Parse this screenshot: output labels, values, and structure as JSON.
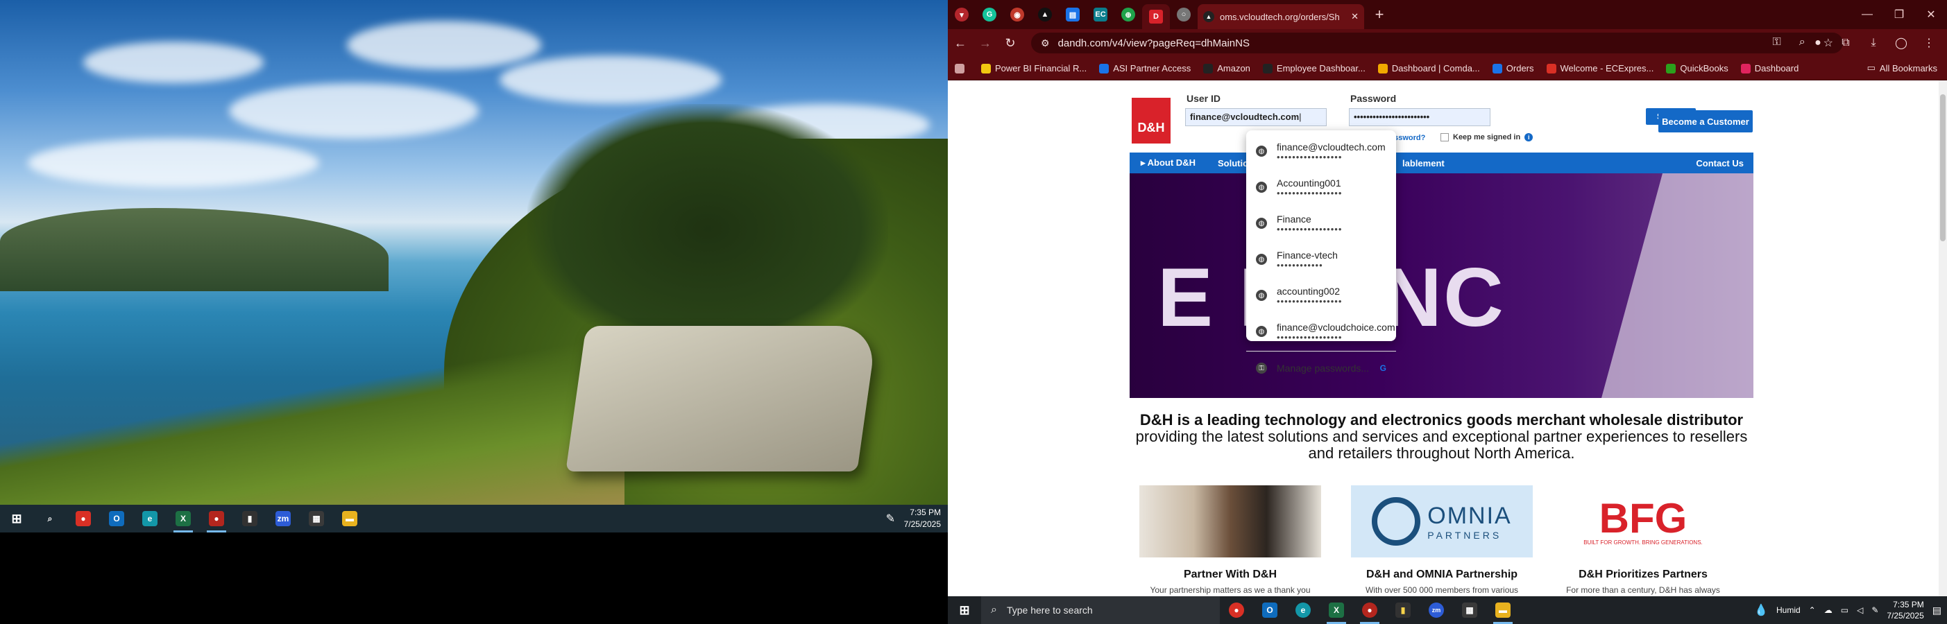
{
  "left_monitor": {
    "taskbar": {
      "icons": [
        {
          "name": "start-icon",
          "glyph": "⊞",
          "color": "#1b2a33",
          "active": false
        },
        {
          "name": "search-icon",
          "glyph": "⌕",
          "color": "#1b2a33",
          "active": false
        },
        {
          "name": "chrome-icon",
          "glyph": "●",
          "color": "#d93025",
          "active": false
        },
        {
          "name": "outlook-icon",
          "glyph": "O",
          "color": "#0f6cbd",
          "active": false
        },
        {
          "name": "edge-icon",
          "glyph": "e",
          "color": "#1397a8",
          "active": false
        },
        {
          "name": "excel-icon",
          "glyph": "X",
          "color": "#1d7044",
          "active": true
        },
        {
          "name": "chrome-profile-icon",
          "glyph": "●",
          "color": "#b3261e",
          "active": true
        },
        {
          "name": "sticky-notes-icon",
          "glyph": "▮",
          "color": "#323232",
          "active": false
        },
        {
          "name": "zoom-icon",
          "glyph": "zm",
          "color": "#2d5cd6",
          "active": false
        },
        {
          "name": "calculator-icon",
          "glyph": "▦",
          "color": "#3a3a3a",
          "active": false
        },
        {
          "name": "file-explorer-icon",
          "glyph": "▬",
          "color": "#e8b21f",
          "active": false
        }
      ],
      "time": "7:35 PM",
      "date": "7/25/2025"
    }
  },
  "browser": {
    "accent": "#5a0b10",
    "tabs": {
      "favicons": [
        "profile-menu",
        "grammarly",
        "tab-red",
        "tab-black",
        "tab-google-docs",
        "tab-ec",
        "tab-green",
        "tab-active-red",
        "tab-gray"
      ],
      "active_tab_title": "oms.vcloudtech.org/orders/Sh"
    },
    "url": "dandh.com/v4/view?pageReq=dhMainNS",
    "bookmarks": [
      {
        "label": "",
        "color": "#cfa0a0"
      },
      {
        "label": "Power BI Financial R...",
        "color": "#f2c811"
      },
      {
        "label": "ASI Partner Access",
        "color": "#1a73e8"
      },
      {
        "label": "Amazon",
        "color": "#222222"
      },
      {
        "label": "Employee Dashboar...",
        "color": "#222222"
      },
      {
        "label": "Dashboard | Comda...",
        "color": "#f2a900"
      },
      {
        "label": "Orders",
        "color": "#1a73e8"
      },
      {
        "label": "Welcome - ECExpres...",
        "color": "#d93025"
      },
      {
        "label": "QuickBooks",
        "color": "#2ca01c"
      },
      {
        "label": "Dashboard",
        "color": "#e0245e"
      }
    ],
    "all_bookmarks": "All Bookmarks"
  },
  "page": {
    "logo_text": "D&H",
    "user_id_label": "User ID",
    "user_id_value": "finance@vcloudtech.com",
    "password_label": "Password",
    "password_value": "••••••••••••••••••••••••",
    "signin_label": "Sign In",
    "forgot_label": "assword?",
    "keep_label": "Keep me signed in",
    "become_label": "Become a Customer",
    "nav": [
      "About D&H",
      "Solutio",
      "lablement"
    ],
    "nav_contact": "Contact Us",
    "hero_text": "E   RIENC",
    "headline_bold": "D&H is a leading technology and electronics goods merchant wholesale distributor",
    "headline_rest": "providing the latest solutions and services and exceptional partner experiences to resellers and retailers throughout North America.",
    "cards": [
      {
        "title": "Partner With D&H",
        "desc": "Your partnership matters as we a thank you"
      },
      {
        "title": "D&H and OMNIA Partnership",
        "desc": "With over 500 000 members from various"
      },
      {
        "title": "D&H Prioritizes Partners",
        "desc": "For more than a century, D&H has always"
      }
    ],
    "card_logos": {
      "omnia": "OMNIA",
      "omnia_sub": "PARTNERS",
      "bfg": "BFG",
      "bfg_sub": "BUILT FOR GROWTH. BRING GENERATIONS."
    }
  },
  "autofill": {
    "entries": [
      {
        "user": "finance@vcloudtech.com",
        "pwd": "•••••••••••••••••"
      },
      {
        "user": "Accounting001",
        "pwd": "•••••••••••••••••"
      },
      {
        "user": "Finance",
        "pwd": "•••••••••••••••••"
      },
      {
        "user": "Finance-vtech",
        "pwd": "••••••••••••"
      },
      {
        "user": "accounting002",
        "pwd": "•••••••••••••••••"
      },
      {
        "user": "finance@vcloudchoice.com",
        "pwd": "•••••••••••••••••"
      }
    ],
    "manage": "Manage passwords...",
    "manage_badge": "G"
  },
  "right_taskbar": {
    "search_placeholder": "Type here to search",
    "weather": "Humid",
    "time": "7:35 PM",
    "date": "7/25/2025"
  }
}
